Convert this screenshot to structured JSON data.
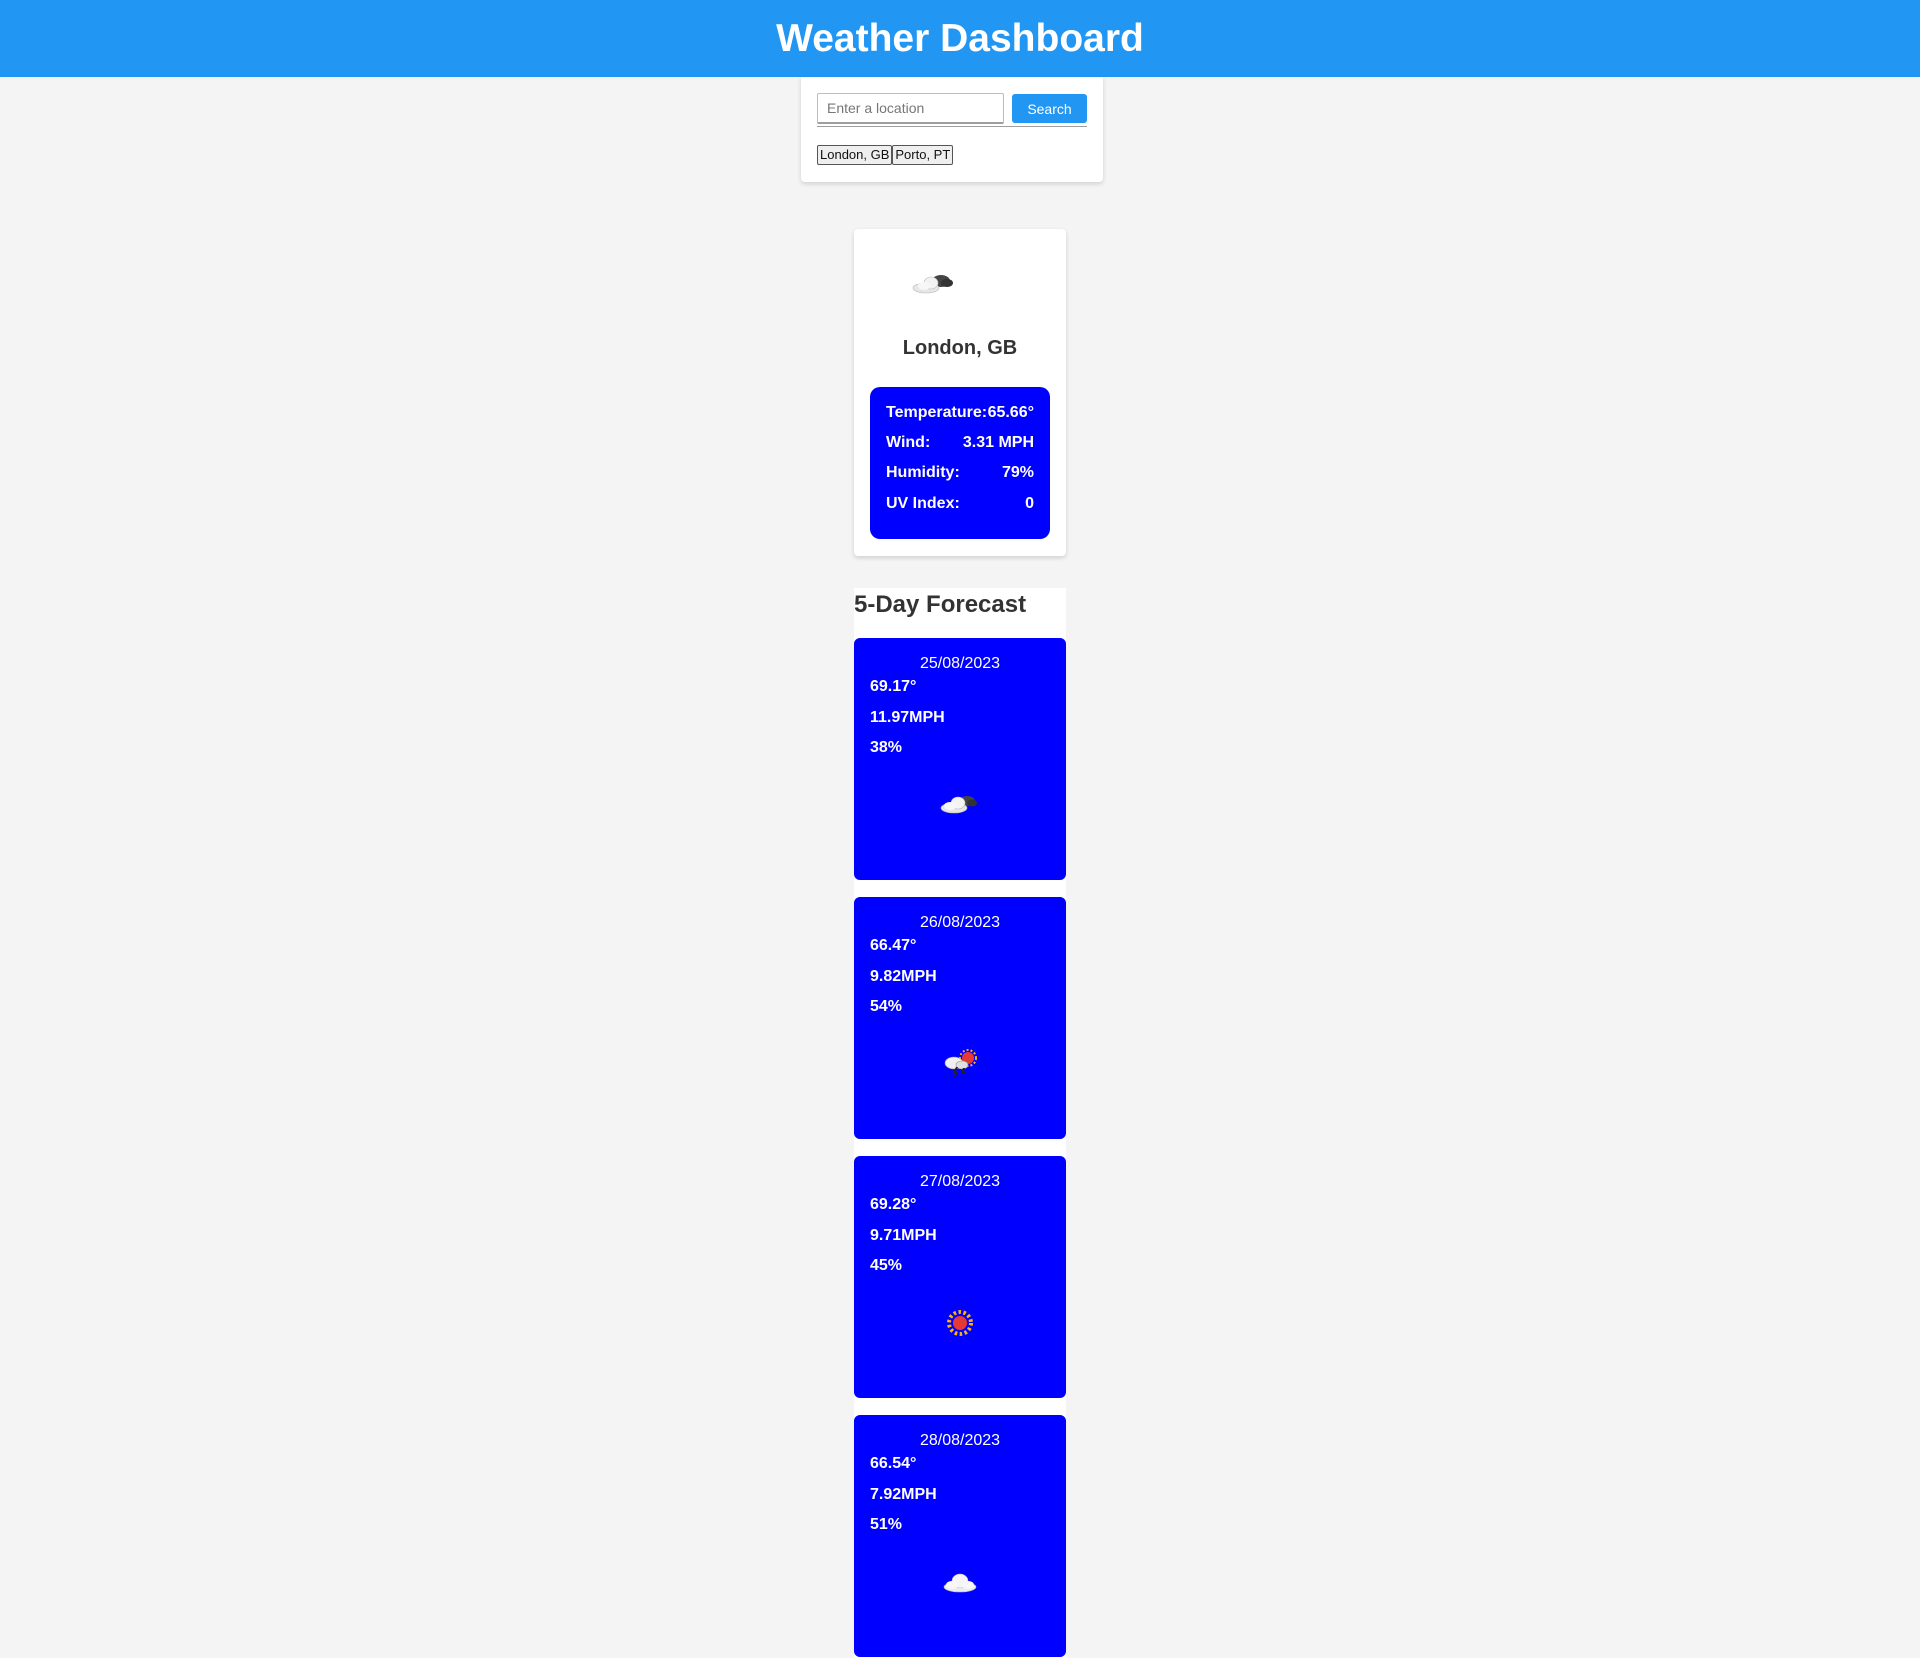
{
  "header": {
    "title": "Weather Dashboard"
  },
  "search": {
    "placeholder": "Enter a location",
    "value": "",
    "button_label": "Search",
    "history": [
      "London, GB",
      "Porto, PT"
    ]
  },
  "current": {
    "city": "London, GB",
    "icon": "partly-cloudy-icon",
    "stats": [
      {
        "label": "Temperature:",
        "value": "65.66°"
      },
      {
        "label": "Wind:",
        "value": "3.31 MPH"
      },
      {
        "label": "Humidity:",
        "value": "79%"
      },
      {
        "label": "UV Index:",
        "value": "0"
      }
    ]
  },
  "forecast": {
    "title": "5-Day Forecast",
    "days": [
      {
        "date": "25/08/2023",
        "temp": "69.17°",
        "wind": "11.97MPH",
        "humidity": "38%",
        "icon": "partly-cloudy-icon"
      },
      {
        "date": "26/08/2023",
        "temp": "66.47°",
        "wind": "9.82MPH",
        "humidity": "54%",
        "icon": "thunderstorm-sun-icon"
      },
      {
        "date": "27/08/2023",
        "temp": "69.28°",
        "wind": "9.71MPH",
        "humidity": "45%",
        "icon": "sun-icon"
      },
      {
        "date": "28/08/2023",
        "temp": "66.54°",
        "wind": "7.92MPH",
        "humidity": "51%",
        "icon": "cloud-icon"
      }
    ]
  },
  "colors": {
    "header_bg": "#2196f3",
    "card_blue": "#0000ff",
    "page_bg": "#f4f4f4"
  }
}
